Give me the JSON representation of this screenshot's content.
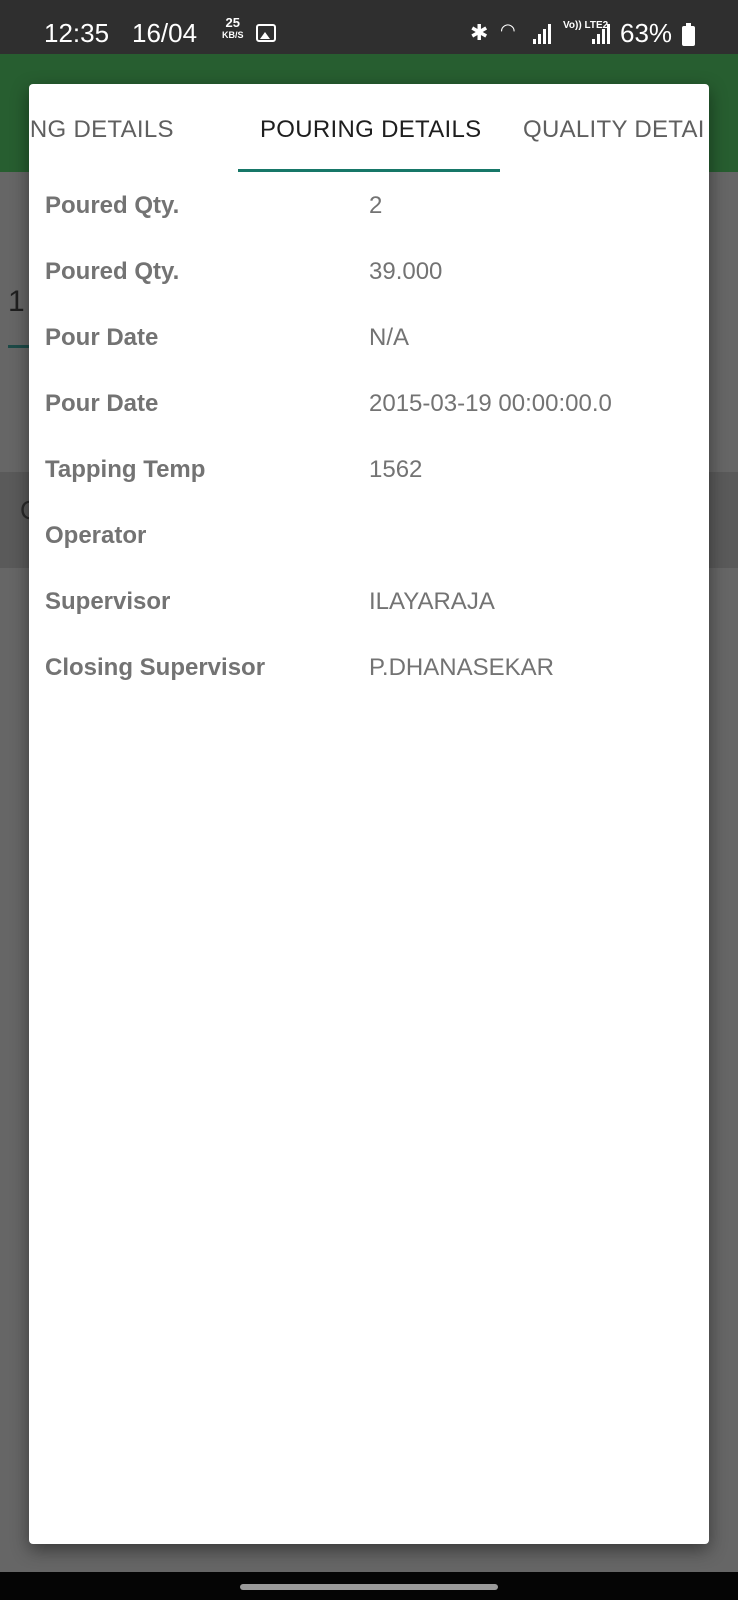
{
  "status_bar": {
    "time": "12:35",
    "date": "16/04",
    "net_speed_value": "25",
    "net_speed_unit": "KB/S",
    "volte": "Vo)) LTE2",
    "battery": "63%",
    "icons": [
      "gallery-icon",
      "bluetooth-icon",
      "wifi-icon",
      "signal-icon",
      "battery-icon"
    ]
  },
  "background": {
    "input_text": "1",
    "row_text": "C"
  },
  "dialog": {
    "tabs": [
      {
        "label": "RKING DETAILS"
      },
      {
        "label": "POURING DETAILS",
        "selected": true
      },
      {
        "label": "QUALITY DETAI"
      }
    ],
    "rows": [
      {
        "label": "Poured Qty.",
        "value": "2"
      },
      {
        "label": "Poured Qty.",
        "value": "39.000"
      },
      {
        "label": "Pour Date",
        "value": "N/A"
      },
      {
        "label": "Pour Date",
        "value": "2015-03-19 00:00:00.0"
      },
      {
        "label": "Tapping Temp",
        "value": "1562"
      },
      {
        "label": "Operator",
        "value": ""
      },
      {
        "label": "Supervisor",
        "value": "ILAYARAJA"
      },
      {
        "label": "Closing Supervisor",
        "value": "P.DHANASEKAR"
      }
    ]
  },
  "colors": {
    "app_header": "#275e30",
    "tab_indicator": "#177768",
    "scrim": "#666666"
  }
}
